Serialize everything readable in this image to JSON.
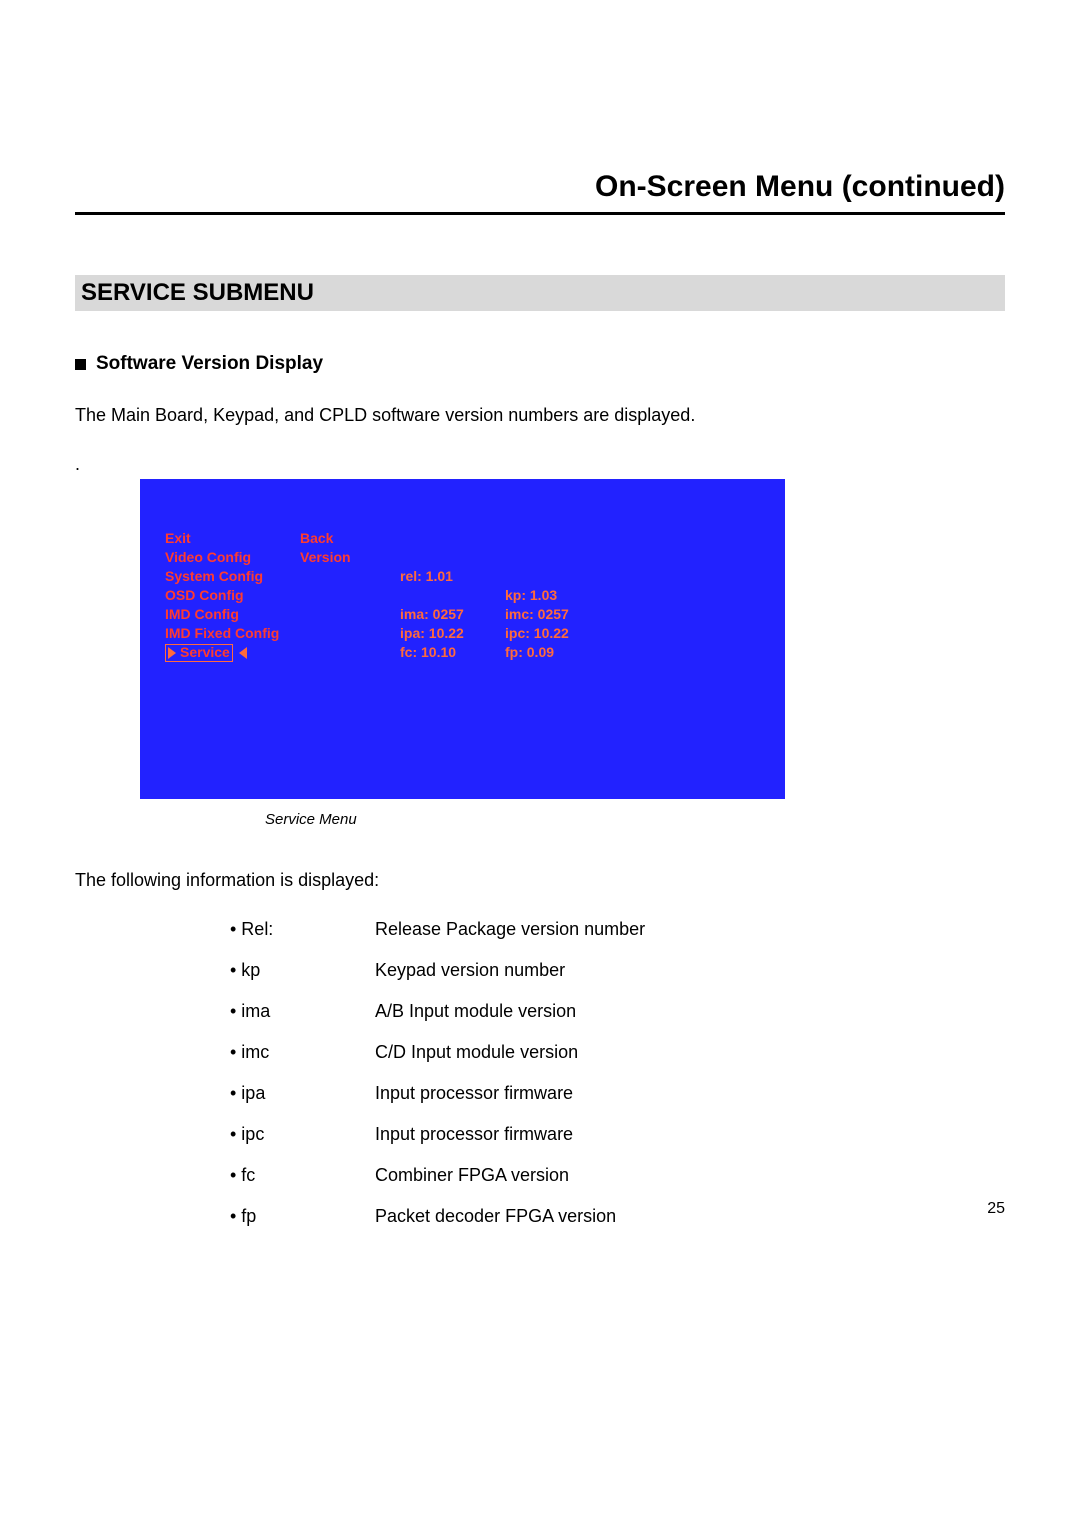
{
  "header": {
    "title": "On-Screen Menu (continued)"
  },
  "section_bar": "SERVICE SUBMENU",
  "sub_heading": "Software Version Display",
  "intro_text": "The Main Board, Keypad, and CPLD software version numbers are displayed.",
  "dot_line": ".",
  "menu": {
    "col1": [
      "Exit",
      "Video Config",
      "System Config",
      "OSD Config",
      "IMD Config",
      "IMD Fixed Config"
    ],
    "service_label": "Service",
    "col2_back": "Back",
    "col2_version": "Version",
    "col3": {
      "rel": "rel: 1.01",
      "blank": "",
      "ima": "ima: 0257",
      "ipa": "ipa: 10.22",
      "fc": "fc:   10.10"
    },
    "col4": {
      "kp": "kp:   1.03",
      "imc": "imc: 0257",
      "ipc": "ipc: 10.22",
      "fp": "fp:   0.09"
    }
  },
  "caption": "Service Menu",
  "following_text": "The following information is displayed:",
  "definitions": [
    {
      "key": "• Rel:",
      "val": "Release Package version number"
    },
    {
      "key": "• kp",
      "val": "Keypad version number"
    },
    {
      "key": "• ima",
      "val": "A/B Input module version"
    },
    {
      "key": "• imc",
      "val": "C/D Input module version"
    },
    {
      "key": "• ipa",
      "val": "Input processor firmware"
    },
    {
      "key": "• ipc",
      "val": "Input processor firmware"
    },
    {
      "key": "• fc",
      "val": "Combiner FPGA version"
    },
    {
      "key": "• fp",
      "val": "Packet decoder FPGA  version"
    }
  ],
  "page_number": "25",
  "chart_data": {
    "type": "table",
    "title": "Service Menu software versions",
    "rows": [
      {
        "field": "rel",
        "value": "1.01"
      },
      {
        "field": "kp",
        "value": "1.03"
      },
      {
        "field": "ima",
        "value": "0257"
      },
      {
        "field": "imc",
        "value": "0257"
      },
      {
        "field": "ipa",
        "value": "10.22"
      },
      {
        "field": "ipc",
        "value": "10.22"
      },
      {
        "field": "fc",
        "value": "10.10"
      },
      {
        "field": "fp",
        "value": "0.09"
      }
    ]
  }
}
